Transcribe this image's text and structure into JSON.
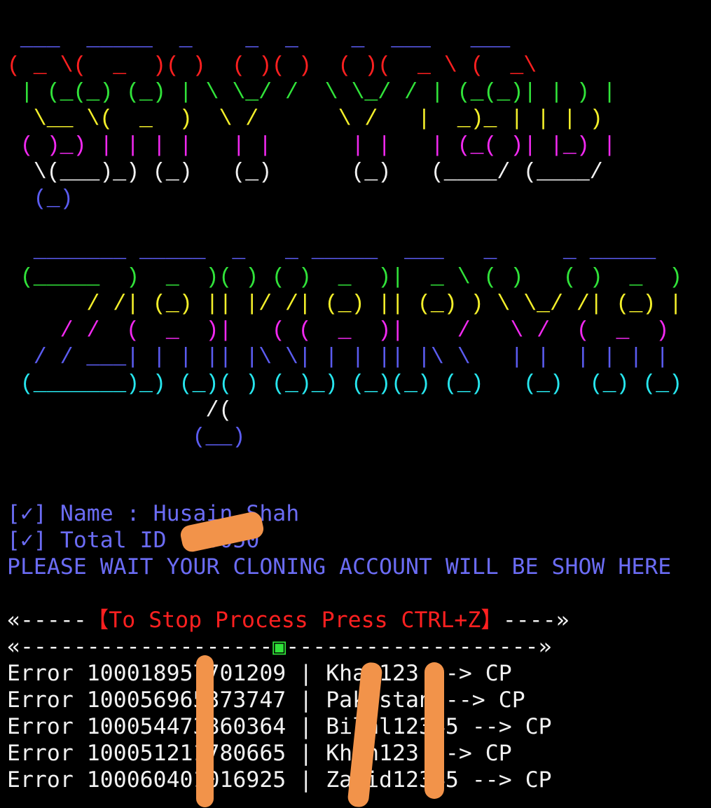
{
  "banner_top": {
    "lines": [
      {
        "text": " ___  _____  _    _  _    _  ___   ___ ",
        "color": "#5b5cf0"
      },
      {
        "text": "( _ \\(  _  )( )  ( )( )  ( )(  _ \\ (  _\\",
        "color": "#ff2020"
      },
      {
        "text": " | (_(_) (_) | \\ \\_/ /  \\ \\_/ / | (_(_)| | ) |",
        "color": "#31e33a"
      },
      {
        "text": "  \\__ \\(  _  )  \\ /      \\ /   |  _)_ | | | )",
        "color": "#f3ef2a"
      },
      {
        "text": " ( )_) | | | |   | |      | |   | (_( )| |_) |",
        "color": "#f129f0"
      },
      {
        "text": "  \\(___)_) (_)   (_)      (_)   (____/ (____/",
        "color": "#f2f2f2"
      },
      {
        "text": "  (_)",
        "color": "#5b5cf0"
      }
    ]
  },
  "banner_bottom": {
    "lines": [
      {
        "text": "  _______ _____  _   _ _____  ___   _     _ _____",
        "color": "#5b5cf0"
      },
      {
        "text": " (_____  )  _  )( ) ( )  _  )|  _ \\ ( )   ( )  _  )",
        "color": "#31e33a"
      },
      {
        "text": "      / /| (_) || |/ /| (_) || (_) ) \\ \\_/ /| (_) |",
        "color": "#f3ef2a"
      },
      {
        "text": "    / /  (  _  )|   ( (  _  )|    /   \\ /  (  _  )",
        "color": "#f129f0"
      },
      {
        "text": "  / / ___| | | || |\\ \\| | | || |\\ \\   | |  | | | |",
        "color": "#5b5cf0"
      },
      {
        "text": " (_______)_) (_)( ) (_)_) (_)(_) (_)   (_)  (_) (_)",
        "color": "#27e6ee"
      },
      {
        "text": "               /(",
        "color": "#f2f2f2"
      },
      {
        "text": "              (__)",
        "color": "#5b5cf0"
      }
    ]
  },
  "info": {
    "name_line": "[✓] Name : Husain Shah",
    "total_line": "[✓] Total ID : 5050",
    "wait_line": "PLEASE WAIT YOUR CLONING ACCOUNT WILL BE SHOW HERE"
  },
  "stop": {
    "left_arrow": "«-----",
    "text": "【To Stop Process Press CTRL+Z】",
    "right_arrow": "----»"
  },
  "separator": {
    "left": "«-------------------",
    "mark": "▣",
    "right": "-------------------»"
  },
  "results": [
    {
      "status": "Error",
      "id": "100018957701209",
      "password": "Khan123",
      "arrow": "-->",
      "tag": "CP"
    },
    {
      "status": "Error",
      "id": "100056965373747",
      "password": "Pakistan",
      "arrow": "-->",
      "tag": "CP"
    },
    {
      "status": "Error",
      "id": "100054473860364",
      "password": "Bilal12345",
      "arrow": "-->",
      "tag": "CP"
    },
    {
      "status": "Error",
      "id": "100051211780665",
      "password": "Khan123",
      "arrow": "-->",
      "tag": "CP"
    },
    {
      "status": "Error",
      "id": "100060401016925",
      "password": "Zahid12345",
      "arrow": "-->",
      "tag": "CP"
    }
  ],
  "colors": {
    "background": "#000000",
    "redaction": "#f2934a"
  }
}
